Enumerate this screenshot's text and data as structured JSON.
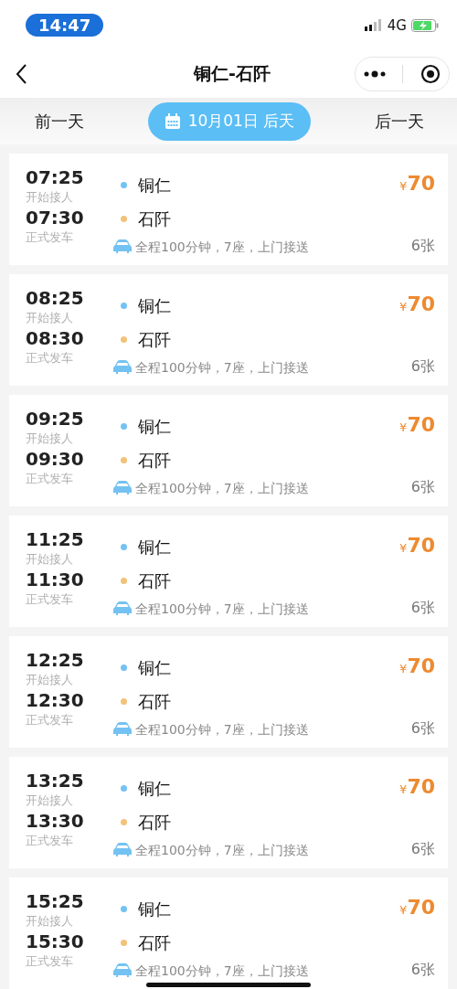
{
  "status_bar": {
    "time": "14:47",
    "network": "4G"
  },
  "nav": {
    "title": "铜仁-石阡"
  },
  "date_bar": {
    "prev": "前一天",
    "date": "10月01日 后天",
    "next": "后一天"
  },
  "trips": [
    {
      "pickup_time": "07:25",
      "pickup_label": "开始接人",
      "depart_time": "07:30",
      "depart_label": "正式发车",
      "from": "铜仁",
      "to": "石阡",
      "info": "全程100分钟，7座，上门接送",
      "currency": "¥",
      "price": "70",
      "seats": "6张"
    },
    {
      "pickup_time": "08:25",
      "pickup_label": "开始接人",
      "depart_time": "08:30",
      "depart_label": "正式发车",
      "from": "铜仁",
      "to": "石阡",
      "info": "全程100分钟，7座，上门接送",
      "currency": "¥",
      "price": "70",
      "seats": "6张"
    },
    {
      "pickup_time": "09:25",
      "pickup_label": "开始接人",
      "depart_time": "09:30",
      "depart_label": "正式发车",
      "from": "铜仁",
      "to": "石阡",
      "info": "全程100分钟，7座，上门接送",
      "currency": "¥",
      "price": "70",
      "seats": "6张"
    },
    {
      "pickup_time": "11:25",
      "pickup_label": "开始接人",
      "depart_time": "11:30",
      "depart_label": "正式发车",
      "from": "铜仁",
      "to": "石阡",
      "info": "全程100分钟，7座，上门接送",
      "currency": "¥",
      "price": "70",
      "seats": "6张"
    },
    {
      "pickup_time": "12:25",
      "pickup_label": "开始接人",
      "depart_time": "12:30",
      "depart_label": "正式发车",
      "from": "铜仁",
      "to": "石阡",
      "info": "全程100分钟，7座，上门接送",
      "currency": "¥",
      "price": "70",
      "seats": "6张"
    },
    {
      "pickup_time": "13:25",
      "pickup_label": "开始接人",
      "depart_time": "13:30",
      "depart_label": "正式发车",
      "from": "铜仁",
      "to": "石阡",
      "info": "全程100分钟，7座，上门接送",
      "currency": "¥",
      "price": "70",
      "seats": "6张"
    },
    {
      "pickup_time": "15:25",
      "pickup_label": "开始接人",
      "depart_time": "15:30",
      "depart_label": "正式发车",
      "from": "铜仁",
      "to": "石阡",
      "info": "全程100分钟，7座，上门接送",
      "currency": "¥",
      "price": "70",
      "seats": "6张"
    }
  ]
}
